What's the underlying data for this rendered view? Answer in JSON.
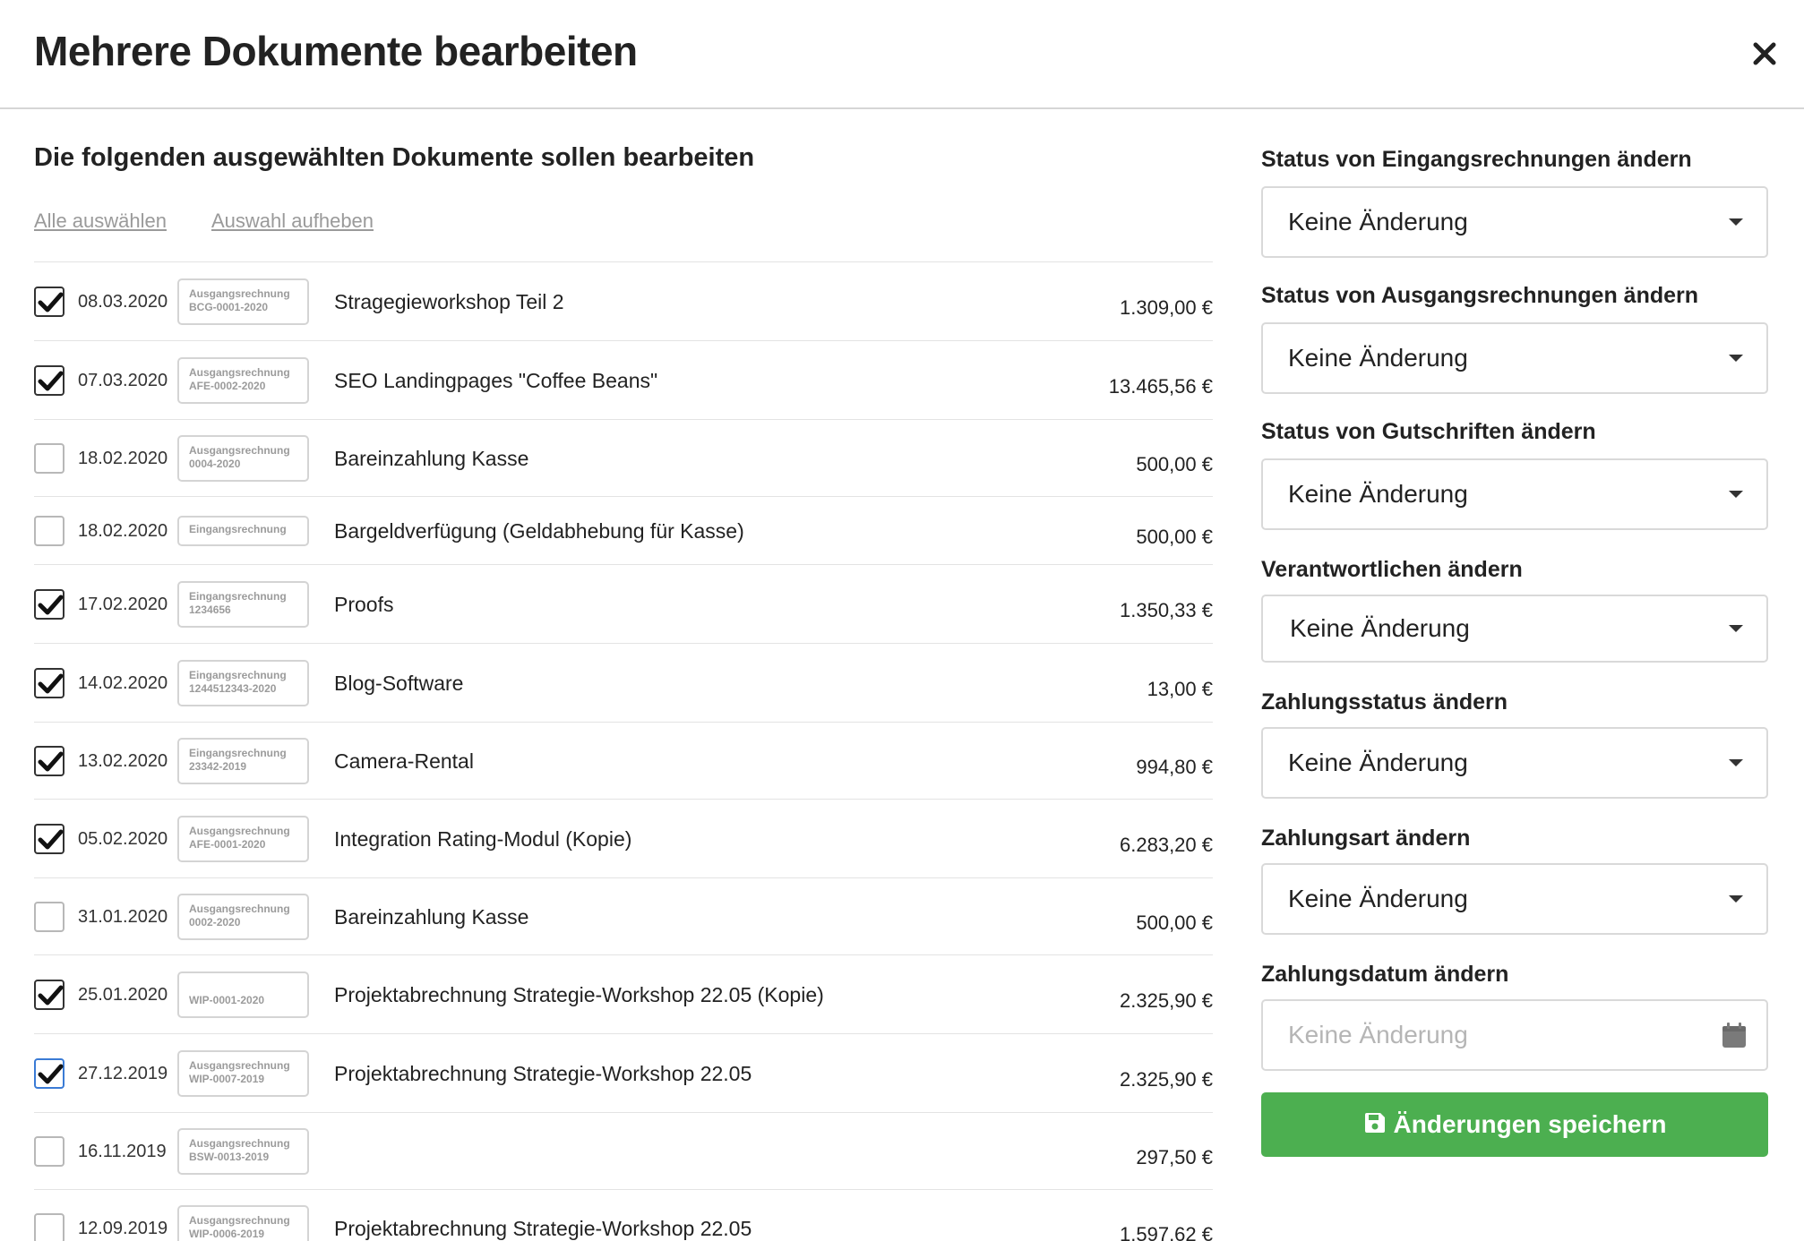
{
  "modal": {
    "title": "Mehrere Dokumente bearbeiten"
  },
  "list": {
    "heading": "Die folgenden ausgewählten Dokumente sollen bearbeiten",
    "select_all": "Alle auswählen",
    "deselect_all": "Auswahl aufheben",
    "documents": [
      {
        "checked": true,
        "date": "08.03.2020",
        "type": "Ausgangsrechnung",
        "number": "BCG-0001-2020",
        "title": "Stragegieworkshop Teil 2",
        "amount": "1.309,00 €"
      },
      {
        "checked": true,
        "date": "07.03.2020",
        "type": "Ausgangsrechnung",
        "number": "AFE-0002-2020",
        "title": "SEO Landingpages \"Coffee Beans\"",
        "amount": "13.465,56 €"
      },
      {
        "checked": false,
        "date": "18.02.2020",
        "type": "Ausgangsrechnung",
        "number": "0004-2020",
        "title": "Bareinzahlung Kasse",
        "amount": "500,00 €"
      },
      {
        "checked": false,
        "date": "18.02.2020",
        "type": "Eingangsrechnung",
        "number": "",
        "title": "Bargeldverfügung (Geldabhebung für Kasse)",
        "amount": "500,00 €"
      },
      {
        "checked": true,
        "date": "17.02.2020",
        "type": "Eingangsrechnung",
        "number": "1234656",
        "title": "Proofs",
        "amount": "1.350,33 €"
      },
      {
        "checked": true,
        "date": "14.02.2020",
        "type": "Eingangsrechnung",
        "number": "1244512343-2020",
        "title": "Blog-Software",
        "amount": "13,00 €"
      },
      {
        "checked": true,
        "date": "13.02.2020",
        "type": "Eingangsrechnung",
        "number": "23342-2019",
        "title": "Camera-Rental",
        "amount": "994,80 €"
      },
      {
        "checked": true,
        "date": "05.02.2020",
        "type": "Ausgangsrechnung",
        "number": "AFE-0001-2020",
        "title": "Integration Rating-Modul (Kopie)",
        "amount": "6.283,20 €"
      },
      {
        "checked": false,
        "date": "31.01.2020",
        "type": "Ausgangsrechnung",
        "number": "0002-2020",
        "title": "Bareinzahlung Kasse",
        "amount": "500,00 €"
      },
      {
        "checked": true,
        "date": "25.01.2020",
        "type": "",
        "number": "WIP-0001-2020",
        "title": "Projektabrechnung Strategie-Workshop 22.05 (Kopie)",
        "amount": "2.325,90 €"
      },
      {
        "checked": true,
        "date": "27.12.2019",
        "type": "Ausgangsrechnung",
        "number": "WIP-0007-2019",
        "title": "Projektabrechnung Strategie-Workshop 22.05",
        "amount": "2.325,90 €"
      },
      {
        "checked": false,
        "date": "16.11.2019",
        "type": "Ausgangsrechnung",
        "number": "BSW-0013-2019",
        "title": "",
        "amount": "297,50 €"
      },
      {
        "checked": false,
        "date": "12.09.2019",
        "type": "Ausgangsrechnung",
        "number": "WIP-0006-2019",
        "title": "Projektabrechnung Strategie-Workshop 22.05",
        "amount": "1.597,62 €"
      }
    ]
  },
  "form": {
    "incoming_status": {
      "label": "Status von Eingangsrechnungen ändern",
      "value": "Keine Änderung"
    },
    "outgoing_status": {
      "label": "Status von Ausgangsrechnungen ändern",
      "value": "Keine Änderung"
    },
    "credit_status": {
      "label": "Status von Gutschriften ändern",
      "value": "Keine Änderung"
    },
    "responsible": {
      "label": "Verantwortlichen ändern",
      "value": "Keine Änderung"
    },
    "payment_status": {
      "label": "Zahlungsstatus ändern",
      "value": "Keine Änderung"
    },
    "payment_method": {
      "label": "Zahlungsart ändern",
      "value": "Keine Änderung"
    },
    "payment_date": {
      "label": "Zahlungsdatum ändern",
      "placeholder": "Keine Änderung"
    },
    "save_label": "Änderungen speichern"
  },
  "colors": {
    "save_button": "#4caf50",
    "badge_text": "#9b9b9b",
    "link_text": "#9a9a9a"
  },
  "icons": [
    "close-icon",
    "check-icon",
    "caret-down-icon",
    "calendar-icon",
    "save-icon"
  ]
}
